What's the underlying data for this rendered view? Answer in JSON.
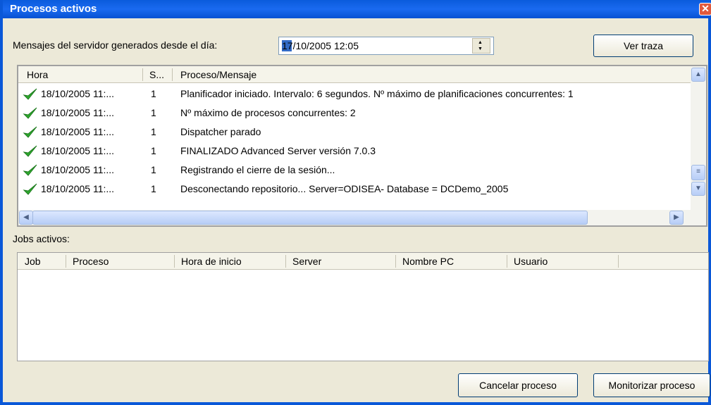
{
  "window": {
    "title": "Procesos activos",
    "close_symbol": "✕"
  },
  "filter": {
    "label": "Mensajes del servidor generados desde el día:",
    "date_value": "17/10/2005 12:05",
    "view_trace_button": "Ver traza"
  },
  "messages": {
    "columns": [
      "Hora",
      "S...",
      "Proceso/Mensaje"
    ],
    "rows": [
      {
        "time": "18/10/2005 11:...",
        "s": "1",
        "message": "Planificador iniciado. Intervalo: 6 segundos. Nº máximo de planificaciones concurrentes: 1"
      },
      {
        "time": "18/10/2005 11:...",
        "s": "1",
        "message": "Nº máximo de procesos concurrentes: 2"
      },
      {
        "time": "18/10/2005 11:...",
        "s": "1",
        "message": "Dispatcher parado"
      },
      {
        "time": "18/10/2005 11:...",
        "s": "1",
        "message": "FINALIZADO Advanced Server versión 7.0.3"
      },
      {
        "time": "18/10/2005 11:...",
        "s": "1",
        "message": "Registrando el cierre de la sesión..."
      },
      {
        "time": "18/10/2005 11:...",
        "s": "1",
        "message": "Desconectando repositorio... Server=ODISEA- Database = DCDemo_2005"
      }
    ],
    "row_icon": "check-icon",
    "check_color": "#2fa82f"
  },
  "jobs": {
    "label": "Jobs activos:",
    "columns": [
      "Job",
      "Proceso",
      "Hora de inicio",
      "Server",
      "Nombre PC",
      "Usuario"
    ]
  },
  "actions": {
    "cancel_button": "Cancelar proceso",
    "monitor_button": "Monitorizar proceso"
  },
  "colors": {
    "titlebar": "#0a5bdc",
    "selection": "#316ac5",
    "window_bg": "#ece9d8"
  }
}
